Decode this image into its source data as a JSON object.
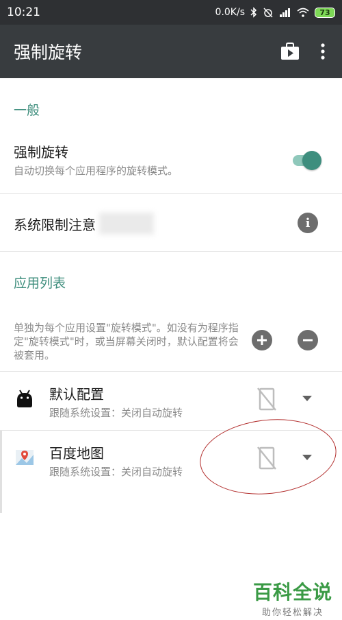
{
  "status": {
    "time": "10:21",
    "speed": "0.0K/s",
    "battery": "73"
  },
  "appbar": {
    "title": "强制旋转"
  },
  "general": {
    "heading": "一般",
    "force_rotate": {
      "title": "强制旋转",
      "subtitle": "自动切换每个应用程序的旋转模式。"
    },
    "system_limit": {
      "title": "系统限制注意"
    }
  },
  "apps": {
    "heading": "应用列表",
    "description": "单独为每个应用设置\"旋转模式\"。如没有为程序指定\"旋转模式\"时，或当屏幕关闭时，默认配置将会被套用。",
    "items": [
      {
        "name": "默认配置",
        "status": "跟随系统设置：关闭自动旋转"
      },
      {
        "name": "百度地图",
        "status": "跟随系统设置：关闭自动旋转"
      }
    ]
  },
  "watermark": {
    "brand": "百科全说",
    "slogan": "助你轻松解决"
  },
  "colors": {
    "accent": "#3d8d7c",
    "appbar": "#383c3f",
    "statusbar": "#2e3033",
    "watermark": "#3a9a45"
  }
}
